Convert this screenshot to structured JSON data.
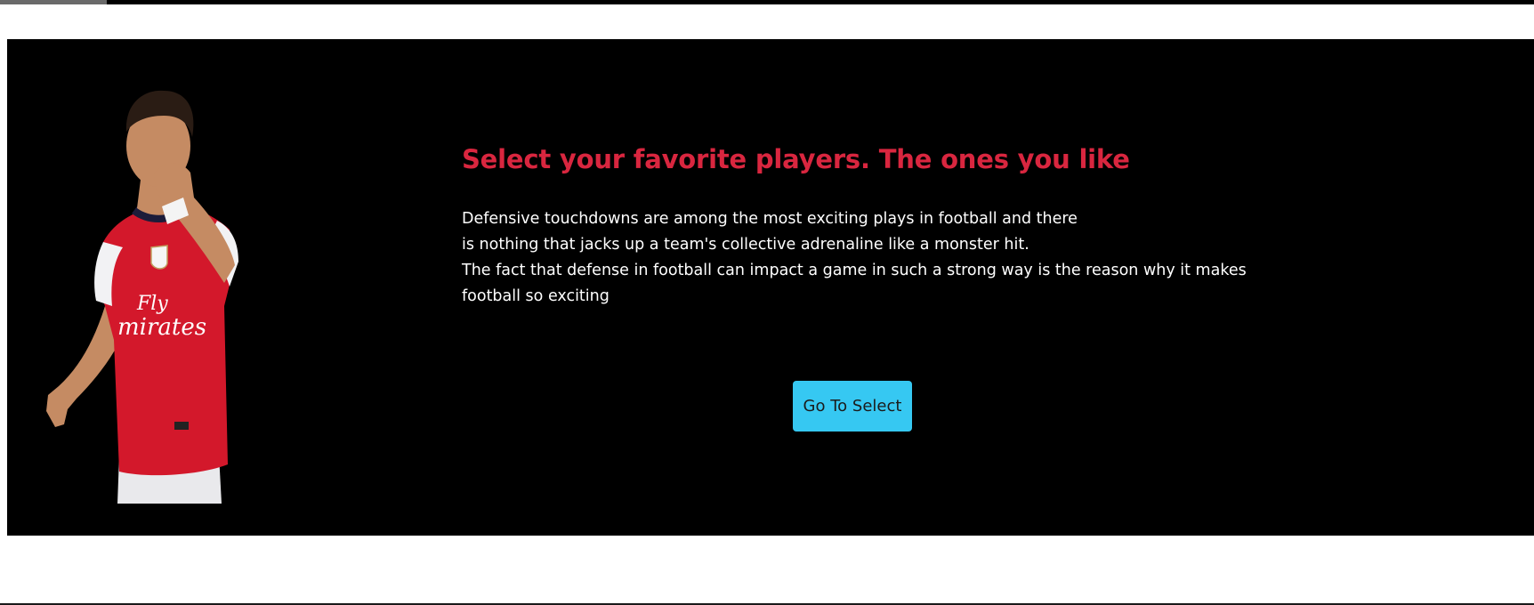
{
  "hero": {
    "headline": "Select your favorite players. The ones you like",
    "paragraph_lines": [
      "Defensive touchdowns are among the most exciting plays in football and there",
      "is nothing that jacks up a team's collective adrenaline like a monster hit.",
      "The fact that defense in football can impact a game in such a strong way is the reason why it makes",
      "football so exciting"
    ],
    "cta_label": "Go To Select",
    "player_image": {
      "shirt_sponsor_line1": "Fly",
      "shirt_sponsor_line2": "mirates"
    }
  },
  "colors": {
    "hero_background": "#000000",
    "headline": "#d9263f",
    "body_text": "#ffffff",
    "cta_background": "#36c8f2",
    "jersey_red": "#d3182b"
  }
}
